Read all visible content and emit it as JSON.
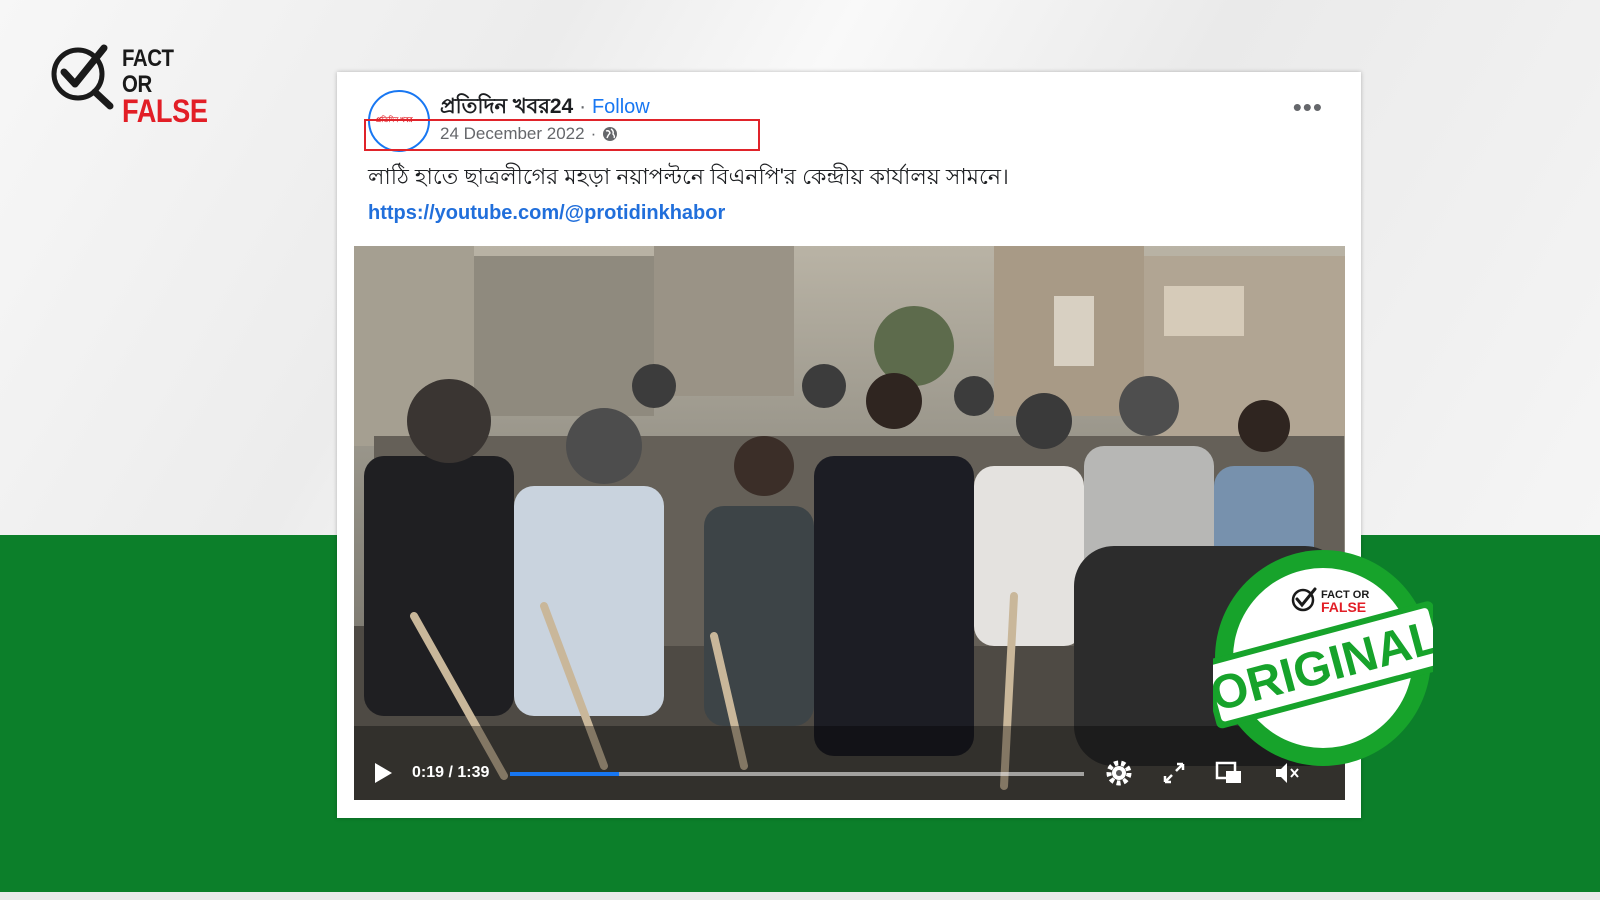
{
  "brand": {
    "line1": "FACT OR",
    "line2": "FALSE"
  },
  "post": {
    "page_name": "প্রতিদিন খবর24",
    "separator": "·",
    "follow_label": "Follow",
    "date": "24 December 2022",
    "date_separator": "·",
    "privacy_icon": "globe-icon",
    "more_icon": "ellipsis-icon",
    "text": "লাঠি হাতে ছাত্রলীগের মহড়া নয়াপল্টনে বিএনপি'র কেন্দ্রীয় কার্যালয় সামনে।",
    "link": "https://youtube.com/@protidinkhabor"
  },
  "video": {
    "time_display": "0:19 / 1:39",
    "progress_fraction": 0.19,
    "icons": [
      "play-icon",
      "settings-icon",
      "fullscreen-icon",
      "pip-icon",
      "mute-icon"
    ]
  },
  "stamp": {
    "label": "ORIGINAL",
    "brand_line1": "FACT OR",
    "brand_line2": "FALSE"
  },
  "colors": {
    "accent_green": "#0c7f2a",
    "brand_red": "#e21e26",
    "facebook_blue": "#1877f2",
    "highlight_red": "#e0232a"
  }
}
